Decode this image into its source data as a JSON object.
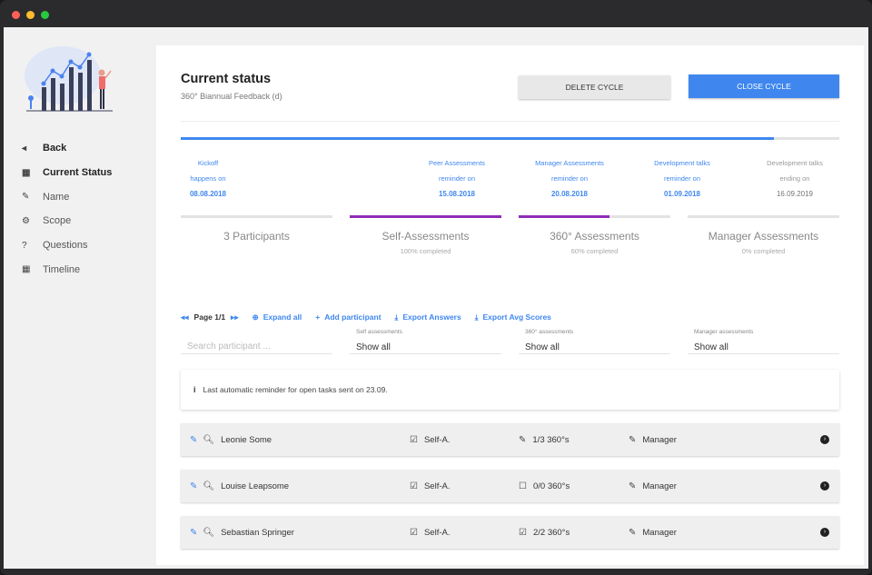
{
  "sidebar": {
    "items": [
      {
        "label": "Back",
        "icon": "chevron-left-icon",
        "glyph": "◂",
        "bold": true
      },
      {
        "label": "Current Status",
        "icon": "calendar-icon",
        "glyph": "▦",
        "bold": true
      },
      {
        "label": "Name",
        "icon": "edit-icon",
        "glyph": "✎",
        "bold": false
      },
      {
        "label": "Scope",
        "icon": "cogs-icon",
        "glyph": "⚙",
        "bold": false
      },
      {
        "label": "Questions",
        "icon": "question-icon",
        "glyph": "?",
        "bold": false
      },
      {
        "label": "Timeline",
        "icon": "calendar-icon",
        "glyph": "▦",
        "bold": false
      }
    ]
  },
  "header": {
    "title": "Current status",
    "subtitle": "360° Biannual Feedback (d)",
    "delete_label": "DELETE CYCLE",
    "close_label": "CLOSE CYCLE"
  },
  "timeline": {
    "progress_fraction": 0.9,
    "accent_color": "#3f87ef",
    "milestones": [
      {
        "line1": "Kickoff",
        "line2": "happens on",
        "date": "08.08.2018",
        "done": true
      },
      {
        "line1": "Peer Assessments",
        "line2": "reminder on",
        "date": "15.08.2018",
        "done": true
      },
      {
        "line1": "Manager Assessments",
        "line2": "reminder on",
        "date": "20.08.2018",
        "done": true
      },
      {
        "line1": "Development talks",
        "line2": "reminder on",
        "date": "01.09.2018",
        "done": true
      },
      {
        "line1": "Development talks",
        "line2": "ending on",
        "date": "16.09.2019",
        "done": false
      }
    ]
  },
  "stats": [
    {
      "label": "3 Participants",
      "pct": "",
      "fill": 0
    },
    {
      "label": "Self-Assessments",
      "pct": "100% completed",
      "fill": 1.0
    },
    {
      "label": "360° Assessments",
      "pct": "60% completed",
      "fill": 0.6
    },
    {
      "label": "Manager Assessments",
      "pct": "0% completed",
      "fill": 0
    }
  ],
  "stat_fill_color": "#8e2fb8",
  "toolbar": {
    "page": "Page 1/1",
    "expand_all": "Expand all",
    "add_participant": "Add participant",
    "export_answers": "Export Answers",
    "export_avg": "Export Avg Scores"
  },
  "filters": {
    "search_placeholder": "Search participant ...",
    "self_label": "Self assessments",
    "self_value": "Show all",
    "peer_label": "360° assessments",
    "peer_value": "Show all",
    "manager_label": "Manager assessments",
    "manager_value": "Show all"
  },
  "notice": {
    "text": "Last automatic reminder for open tasks sent on 23.09."
  },
  "participants": [
    {
      "name": "Leonie Some",
      "self": "Self-A.",
      "self_icon": "checked-box-icon",
      "peer": "1/3 360°s",
      "peer_icon": "edit-icon",
      "manager": "Manager",
      "manager_icon": "edit-icon"
    },
    {
      "name": "Louise Leapsome",
      "self": "Self-A.",
      "self_icon": "checked-box-icon",
      "peer": "0/0 360°s",
      "peer_icon": "empty-box-icon",
      "manager": "Manager",
      "manager_icon": "edit-icon"
    },
    {
      "name": "Sebastian Springer",
      "self": "Self-A.",
      "self_icon": "checked-box-icon",
      "peer": "2/2 360°s",
      "peer_icon": "checked-box-icon",
      "manager": "Manager",
      "manager_icon": "edit-icon"
    }
  ]
}
